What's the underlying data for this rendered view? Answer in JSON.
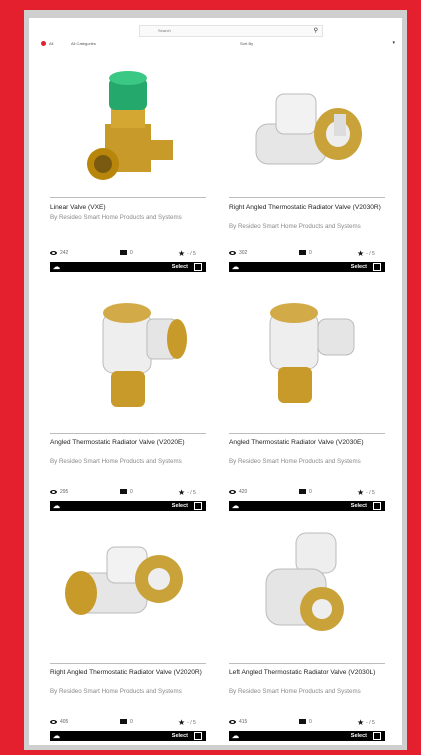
{
  "search": {
    "placeholder": "Search"
  },
  "filters": {
    "language": "All",
    "category": "All Categories",
    "sort": "Sort By"
  },
  "products": [
    {
      "title": "Linear Valve (VXE)",
      "vendor": "By Resideo Smart Home Products and Systems",
      "views": "242",
      "comments": "0",
      "rating": "- / 5",
      "select": "Select",
      "img": "linear"
    },
    {
      "title": "Right Angled Thermostatic Radiator Valve (V2030R)",
      "vendor": "By Resideo Smart Home Products and Systems",
      "views": "302",
      "comments": "0",
      "rating": "- / 5",
      "select": "Select",
      "img": "right-angled"
    },
    {
      "title": "Angled Thermostatic Radiator Valve (V2020E)",
      "vendor": "By Resideo Smart Home Products and Systems",
      "views": "295",
      "comments": "0",
      "rating": "- / 5",
      "select": "Select",
      "img": "angled"
    },
    {
      "title": "Angled Thermostatic Radiator Valve (V2030E)",
      "vendor": "By Resideo Smart Home Products and Systems",
      "views": "420",
      "comments": "0",
      "rating": "- / 5",
      "select": "Select",
      "img": "angled2"
    },
    {
      "title": "Right Angled Thermostatic Radiator Valve (V2020R)",
      "vendor": "By Resideo Smart Home Products and Systems",
      "views": "405",
      "comments": "0",
      "rating": "- / 5",
      "select": "Select",
      "img": "right-angled2"
    },
    {
      "title": "Left Angled Thermostatic Radiator Valve (V2030L)",
      "vendor": "By Resideo Smart Home Products and Systems",
      "views": "415",
      "comments": "0",
      "rating": "- / 5",
      "select": "Select",
      "img": "left-angled"
    }
  ]
}
